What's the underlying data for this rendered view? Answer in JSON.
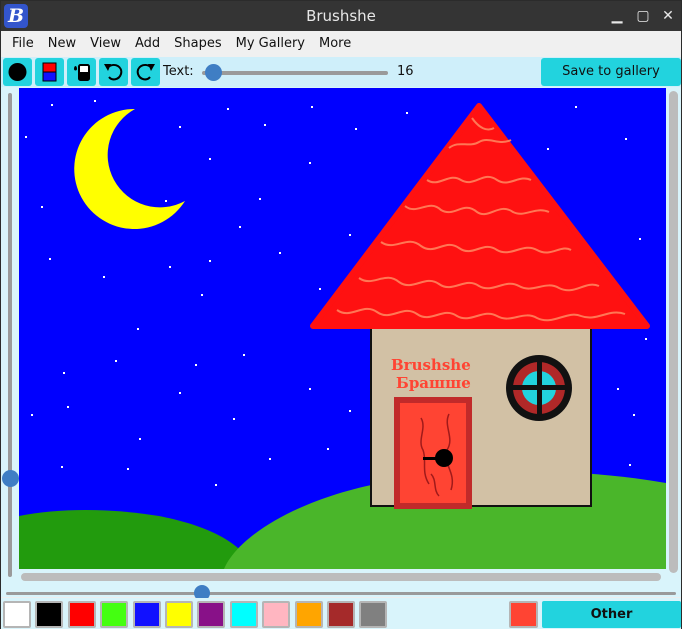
{
  "window": {
    "title": "Brushshe",
    "app_icon_letter": "B",
    "minimize_glyph": "▁",
    "maximize_glyph": "▢",
    "close_glyph": "✕"
  },
  "menu": [
    "File",
    "New",
    "View",
    "Add",
    "Shapes",
    "My Gallery",
    "More"
  ],
  "toolbar": {
    "tools": [
      {
        "name": "brush-size-icon",
        "tooltip": "Brush"
      },
      {
        "name": "color-icon",
        "tooltip": "Color"
      },
      {
        "name": "fill-icon",
        "tooltip": "Fill"
      },
      {
        "name": "undo-icon",
        "tooltip": "Undo"
      },
      {
        "name": "redo-icon",
        "tooltip": "Redo"
      }
    ],
    "text_label": "Text:",
    "text_size": "16",
    "save_label": "Save to gallery"
  },
  "canvas": {
    "background": "#0000ff",
    "sign_line1": "Brushshe",
    "sign_line2": "Брашше"
  },
  "palette": {
    "colors": [
      "#ffffff",
      "#000000",
      "#ff0000",
      "#44ff11",
      "#1111ff",
      "#ffff00",
      "#881188",
      "#00ffff",
      "#ffb6c1",
      "#ffa500",
      "#a52a2a",
      "#808080"
    ],
    "current_color": "#ff4433",
    "other_label": "Other"
  },
  "accent_color": "#22d3de"
}
